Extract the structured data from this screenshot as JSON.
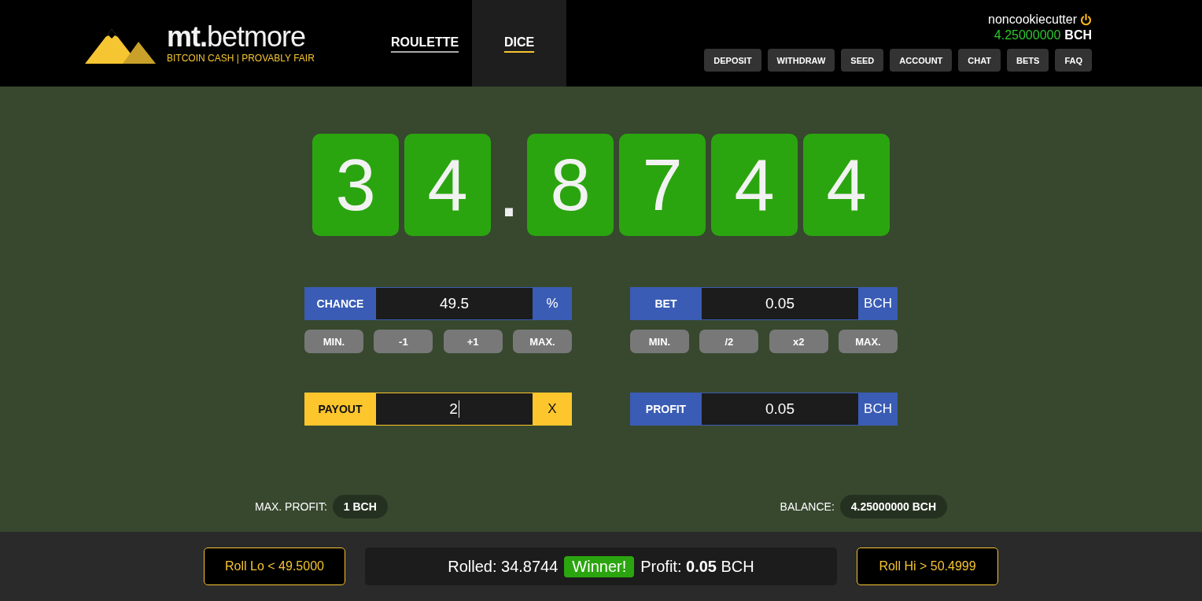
{
  "header": {
    "logo": {
      "name_bold": "mt.",
      "name_rest": "betmore",
      "tagline": "BITCOIN CASH | PROVABLY FAIR"
    },
    "nav": [
      {
        "label": "ROULETTE",
        "selected": false
      },
      {
        "label": "DICE",
        "selected": true
      }
    ],
    "user": {
      "username": "noncookiecutter",
      "balance": "4.25000000",
      "currency": "BCH"
    },
    "menu": [
      "DEPOSIT",
      "WITHDRAW",
      "SEED",
      "ACCOUNT",
      "CHAT",
      "BETS",
      "FAQ"
    ]
  },
  "roll_display": {
    "integer_digits": [
      "3",
      "4"
    ],
    "separator": ".",
    "decimal_digits": [
      "8",
      "7",
      "4",
      "4"
    ]
  },
  "columns": [
    {
      "fields": [
        {
          "label": "CHANCE",
          "value": "49.5",
          "unit": "%",
          "focused": false,
          "buttons": [
            "MIN.",
            "-1",
            "+1",
            "MAX."
          ]
        },
        {
          "label": "PAYOUT",
          "value": "2",
          "unit": "X",
          "focused": true
        }
      ]
    },
    {
      "fields": [
        {
          "label": "BET",
          "value": "0.05",
          "unit": "BCH",
          "focused": false,
          "buttons": [
            "MIN.",
            "/2",
            "x2",
            "MAX."
          ]
        },
        {
          "label": "PROFIT",
          "value": "0.05",
          "unit": "BCH",
          "focused": false
        }
      ]
    }
  ],
  "info": [
    {
      "label": "MAX. PROFIT:",
      "value": "1 BCH"
    },
    {
      "label": "BALANCE:",
      "value": "4.25000000 BCH"
    }
  ],
  "footer": {
    "roll_lo": "Roll Lo < 49.5000",
    "roll_hi": "Roll Hi > 50.4999",
    "result": {
      "rolled_label": "Rolled:",
      "rolled_value": "34.8744",
      "outcome": "Winner!",
      "profit_label": "Profit:",
      "profit_value": "0.05",
      "currency": "BCH"
    }
  }
}
